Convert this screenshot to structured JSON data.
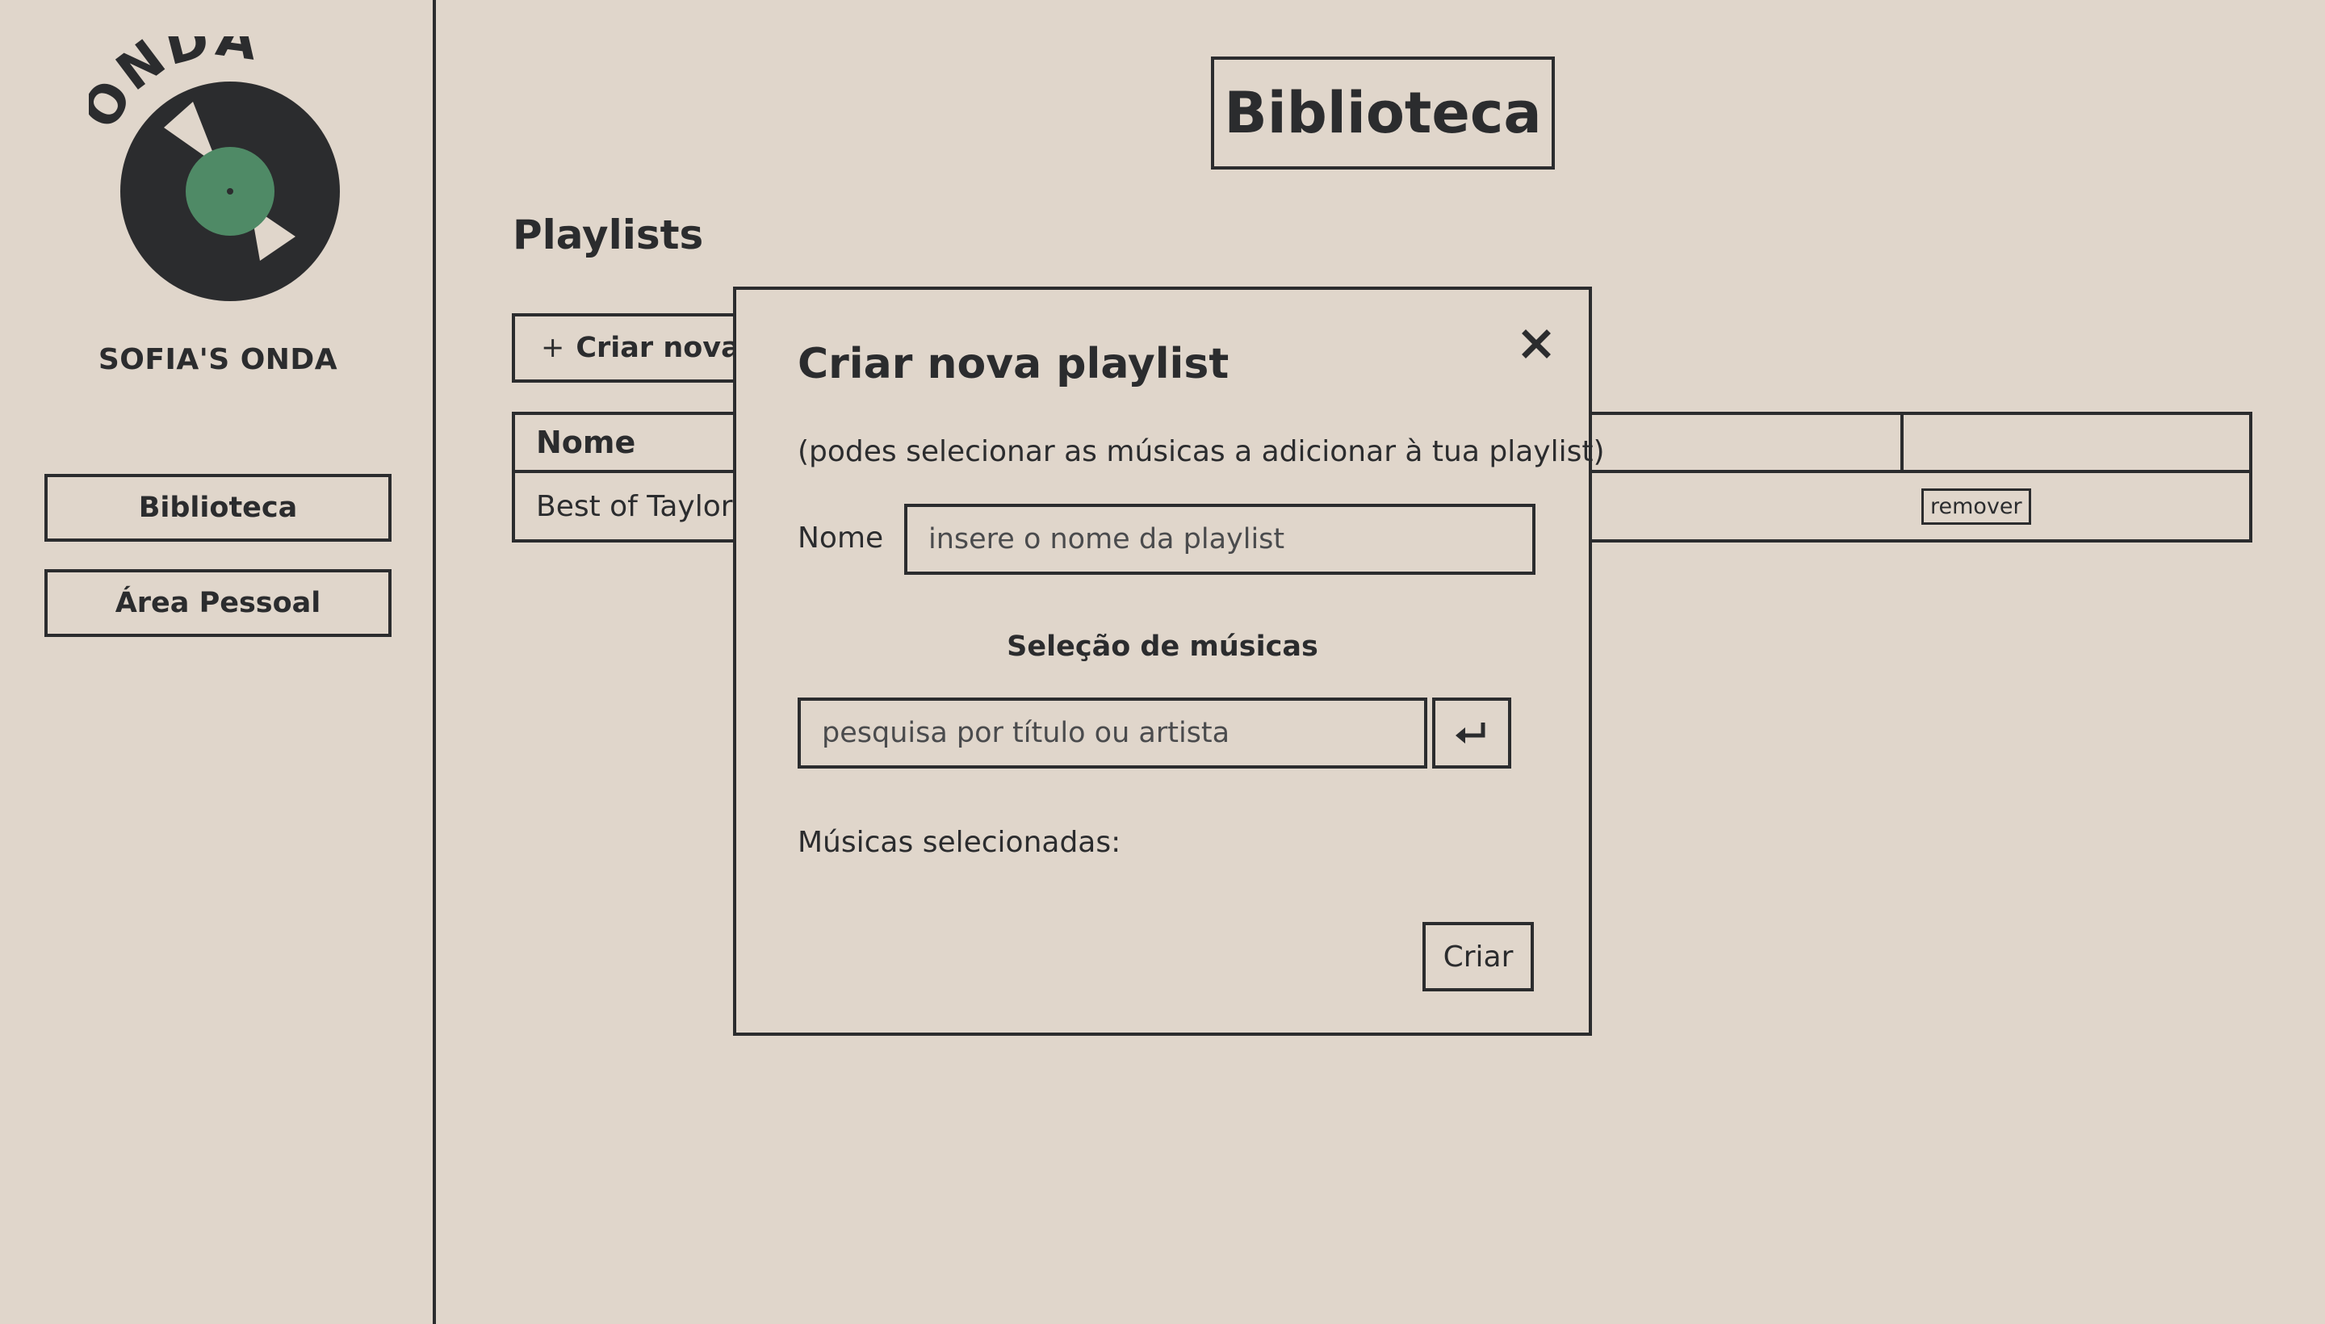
{
  "app": {
    "logo_text": "ONDA",
    "brand": "SOFIA'S ONDA",
    "accent_color": "#4f8a66"
  },
  "sidebar": {
    "items": [
      {
        "label": "Biblioteca"
      },
      {
        "label": "Área Pessoal"
      }
    ]
  },
  "main": {
    "page_title": "Biblioteca",
    "section_title": "Playlists",
    "create_button": {
      "icon": "plus-icon",
      "label": "Criar nova playlist"
    },
    "table": {
      "headers": [
        "Nome",
        ""
      ],
      "rows": [
        {
          "name": "Best of Taylor",
          "action": "remover"
        }
      ]
    }
  },
  "modal": {
    "title": "Criar nova playlist",
    "close_icon": "close-icon",
    "subtitle": "(podes selecionar as músicas a adicionar à tua playlist)",
    "name_label": "Nome",
    "name_placeholder": "insere o nome da playlist",
    "selection_title": "Seleção de músicas",
    "search_placeholder": "pesquisa por título ou artista",
    "enter_icon": "enter-icon",
    "selected_label": "Músicas selecionadas:",
    "submit_label": "Criar"
  }
}
